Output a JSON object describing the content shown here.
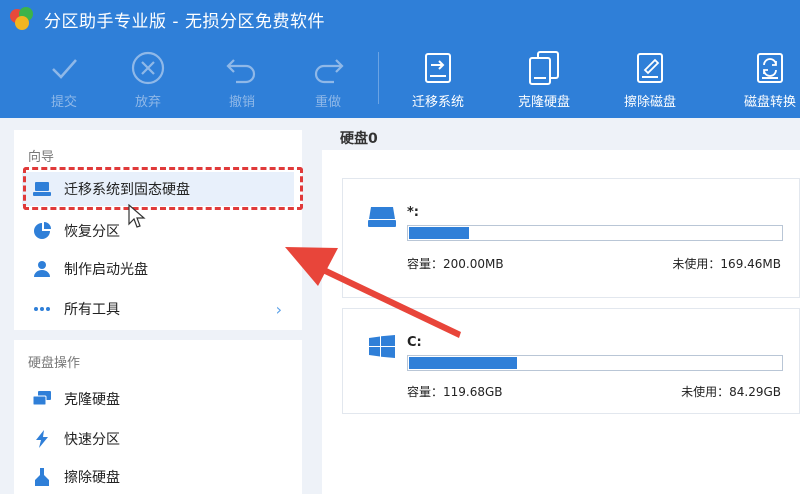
{
  "window": {
    "title": "分区助手专业版 - 无损分区免费软件"
  },
  "toolbar": {
    "items": [
      {
        "label": "提交",
        "icon": "check-icon",
        "enabled": false
      },
      {
        "label": "放弃",
        "icon": "discard-icon",
        "enabled": false
      },
      {
        "label": "撤销",
        "icon": "undo-icon",
        "enabled": false
      },
      {
        "label": "重做",
        "icon": "redo-icon",
        "enabled": false
      },
      {
        "label": "迁移系统",
        "icon": "migrate-os-icon",
        "enabled": true
      },
      {
        "label": "克隆硬盘",
        "icon": "clone-disk-icon",
        "enabled": true
      },
      {
        "label": "擦除磁盘",
        "icon": "wipe-disk-icon",
        "enabled": true
      },
      {
        "label": "磁盘转换",
        "icon": "disk-convert-icon",
        "enabled": true
      }
    ]
  },
  "sidebar": {
    "wizard": {
      "heading": "向导",
      "items": [
        {
          "label": "迁移系统到固态硬盘",
          "icon": "ssd-icon",
          "active": true
        },
        {
          "label": "恢复分区",
          "icon": "pie-icon"
        },
        {
          "label": "制作启动光盘",
          "icon": "user-disc-icon"
        },
        {
          "label": "所有工具",
          "icon": "more-dots-icon",
          "chevron": "›"
        }
      ]
    },
    "disk_ops": {
      "heading": "硬盘操作",
      "items": [
        {
          "label": "克隆硬盘",
          "icon": "clone-icon"
        },
        {
          "label": "快速分区",
          "icon": "lightning-icon"
        },
        {
          "label": "擦除硬盘",
          "icon": "erase-icon"
        }
      ]
    }
  },
  "main": {
    "disk_title": "硬盘0",
    "partitions": [
      {
        "name": "*:",
        "icon": "drive-icon",
        "used_fraction": 0.16,
        "capacity": "容量：200.00MB",
        "free": "未使用：169.46MB"
      },
      {
        "name": "C:",
        "icon": "windows-icon",
        "used_fraction": 0.29,
        "capacity": "容量：119.68GB",
        "free": "未使用：84.29GB"
      }
    ]
  },
  "colors": {
    "accent": "#2f7fd8",
    "highlight": "#e03a3a"
  }
}
